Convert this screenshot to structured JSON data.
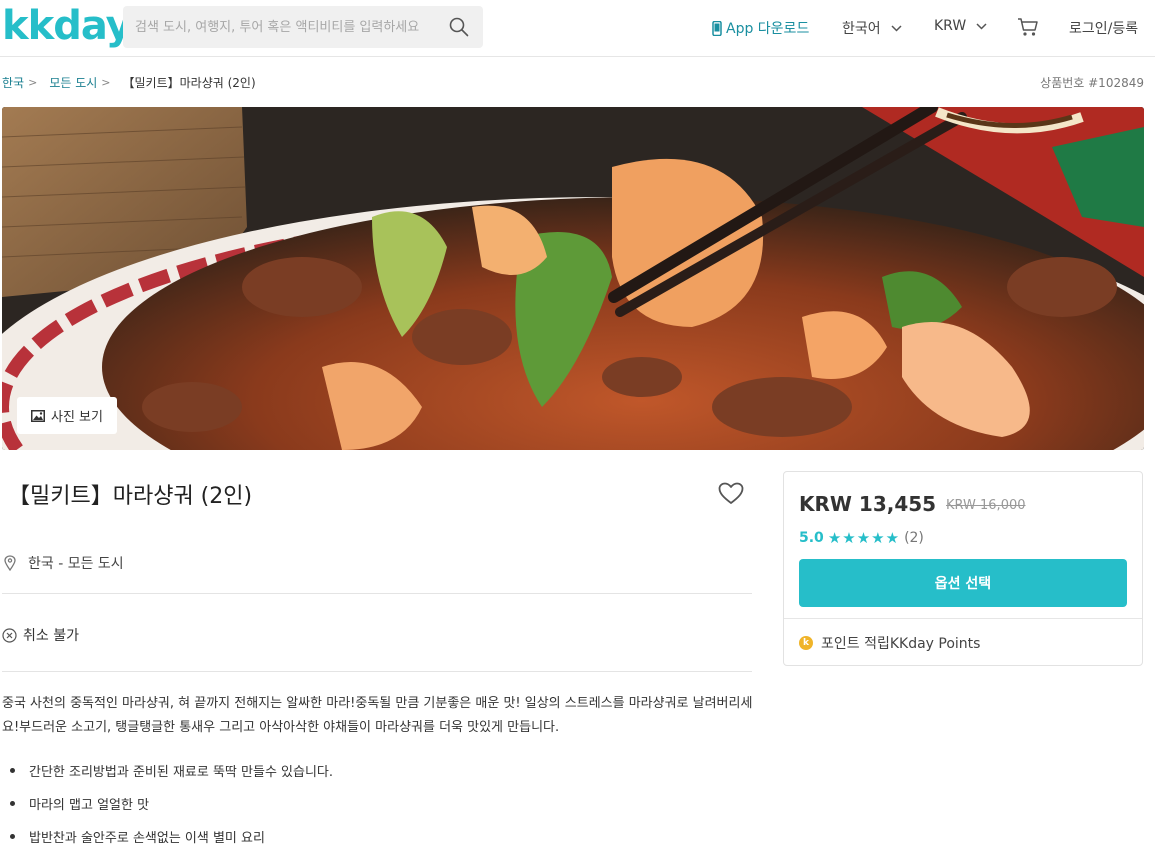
{
  "header": {
    "logo": "kkday",
    "search_placeholder": "검색 도시, 여행지, 투어 혹은 액티비티를 입력하세요",
    "app_download": "App 다운로드",
    "language": "한국어",
    "currency": "KRW",
    "login": "로그인/등록"
  },
  "breadcrumb": {
    "items": [
      "한국",
      "모든 도시",
      "【밀키트】마라샹궈 (2인)"
    ]
  },
  "product_code": "상품번호 #102849",
  "hero": {
    "photo_button": "사진 보기"
  },
  "product": {
    "title": "【밀키트】마라샹궈 (2인)",
    "location": "한국 - 모든 도시",
    "cancel_policy": "취소 불가",
    "description": "중국 사천의 중독적인 마라샹궈, 혀 끝까지 전해지는 알싸한 마라!중독될 만큼 기분좋은 매운 맛! 일상의 스트레스를 마라샹궈로 날려버리세요!부드러운 소고기, 탱글탱글한 통새우 그리고 아삭아삭한 야채들이 마라샹궈를 더욱 맛있게 만듭니다.",
    "highlights": [
      "간단한 조리방법과 준비된 재료로 뚝딱 만들수 있습니다.",
      "마라의 맵고 얼얼한 맛",
      "밥반찬과 술안주로 손색없는 이색 별미 요리"
    ]
  },
  "pricing": {
    "price": "KRW 13,455",
    "original_price": "KRW 16,000",
    "rating_score": "5.0",
    "rating_stars": 5,
    "review_count": "(2)",
    "select_button": "옵션 선택",
    "points_text": "포인트 적립KKday Points"
  },
  "colors": {
    "accent": "#26bec9",
    "link": "#1a7f90",
    "coin": "#f0b429"
  }
}
